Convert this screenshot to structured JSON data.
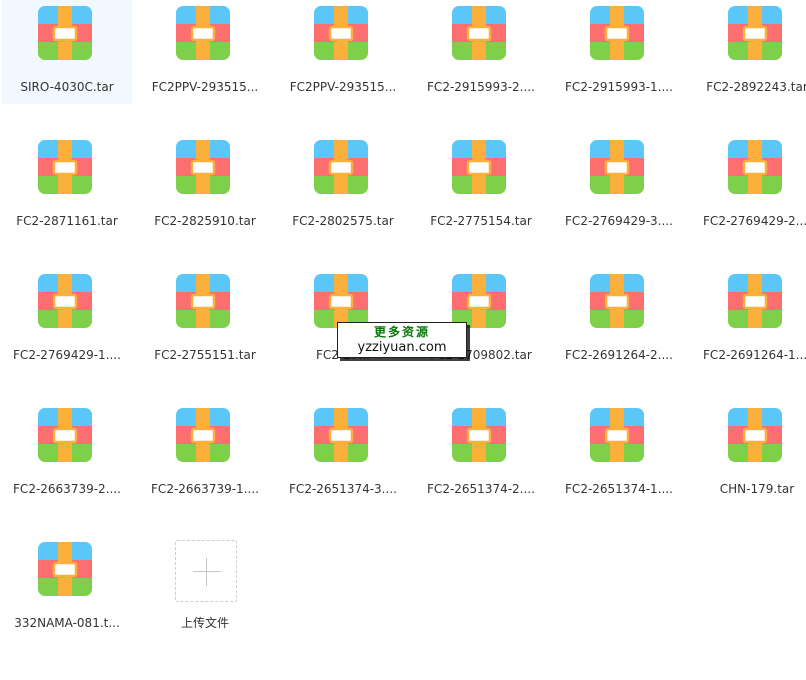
{
  "files": [
    {
      "name": "SIRO-4030C.tar",
      "selected": true
    },
    {
      "name": "FC2PPV-293515..."
    },
    {
      "name": "FC2PPV-293515..."
    },
    {
      "name": "FC2-2915993-2...."
    },
    {
      "name": "FC2-2915993-1...."
    },
    {
      "name": "FC2-2892243.tar"
    },
    {
      "name": "FC2-2871161.tar"
    },
    {
      "name": "FC2-2825910.tar"
    },
    {
      "name": "FC2-2802575.tar"
    },
    {
      "name": "FC2-2775154.tar"
    },
    {
      "name": "FC2-2769429-3...."
    },
    {
      "name": "FC2-2769429-2...."
    },
    {
      "name": "FC2-2769429-1...."
    },
    {
      "name": "FC2-2755151.tar"
    },
    {
      "name": "FC2-27..."
    },
    {
      "name": "FC2-2709802.tar"
    },
    {
      "name": "FC2-2691264-2...."
    },
    {
      "name": "FC2-2691264-1...."
    },
    {
      "name": "FC2-2663739-2...."
    },
    {
      "name": "FC2-2663739-1...."
    },
    {
      "name": "FC2-2651374-3...."
    },
    {
      "name": "FC2-2651374-2...."
    },
    {
      "name": "FC2-2651374-1...."
    },
    {
      "name": "CHN-179.tar"
    },
    {
      "name": "332NAMA-081.t..."
    }
  ],
  "upload": {
    "label": "上传文件"
  },
  "watermark": {
    "line1": "更多资源",
    "line2": "yzziyuan.com"
  },
  "icon_colors": {
    "top": "#5bc7f8",
    "middle": "#fd6e6e",
    "bottom": "#7ed04b",
    "strap": "#fbb03b",
    "buckle": "#ffffff"
  }
}
